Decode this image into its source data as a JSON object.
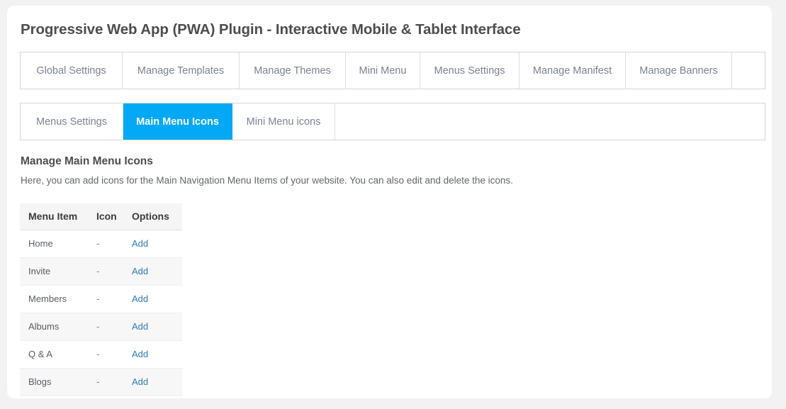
{
  "page": {
    "title": "Progressive Web App (PWA) Plugin - Interactive Mobile & Tablet Interface",
    "background_color": "#f2f2f2",
    "card_color": "#ffffff"
  },
  "primary_tabs": {
    "active_index": -1,
    "items": [
      {
        "label": "Global Settings"
      },
      {
        "label": "Manage Templates"
      },
      {
        "label": "Manage Themes"
      },
      {
        "label": "Mini Menu"
      },
      {
        "label": "Menus Settings"
      },
      {
        "label": "Manage Manifest"
      },
      {
        "label": "Manage Banners"
      }
    ]
  },
  "secondary_tabs": {
    "active_index": 1,
    "active_color": "#03a9f4",
    "items": [
      {
        "label": "Menus Settings"
      },
      {
        "label": "Main Menu Icons"
      },
      {
        "label": "Mini Menu icons"
      }
    ]
  },
  "section": {
    "heading": "Manage Main Menu Icons",
    "description": "Here, you can add icons for the Main Navigation Menu Items of your website. You can also edit and delete the icons."
  },
  "table": {
    "columns": [
      "Menu Item",
      "Icon",
      "Options"
    ],
    "link_color": "#2e7ab3",
    "rows": [
      {
        "menu_item": "Home",
        "icon": "-",
        "option": "Add"
      },
      {
        "menu_item": "Invite",
        "icon": "-",
        "option": "Add"
      },
      {
        "menu_item": "Members",
        "icon": "-",
        "option": "Add"
      },
      {
        "menu_item": "Albums",
        "icon": "-",
        "option": "Add"
      },
      {
        "menu_item": "Q & A",
        "icon": "-",
        "option": "Add"
      },
      {
        "menu_item": "Blogs",
        "icon": "-",
        "option": "Add"
      }
    ]
  }
}
